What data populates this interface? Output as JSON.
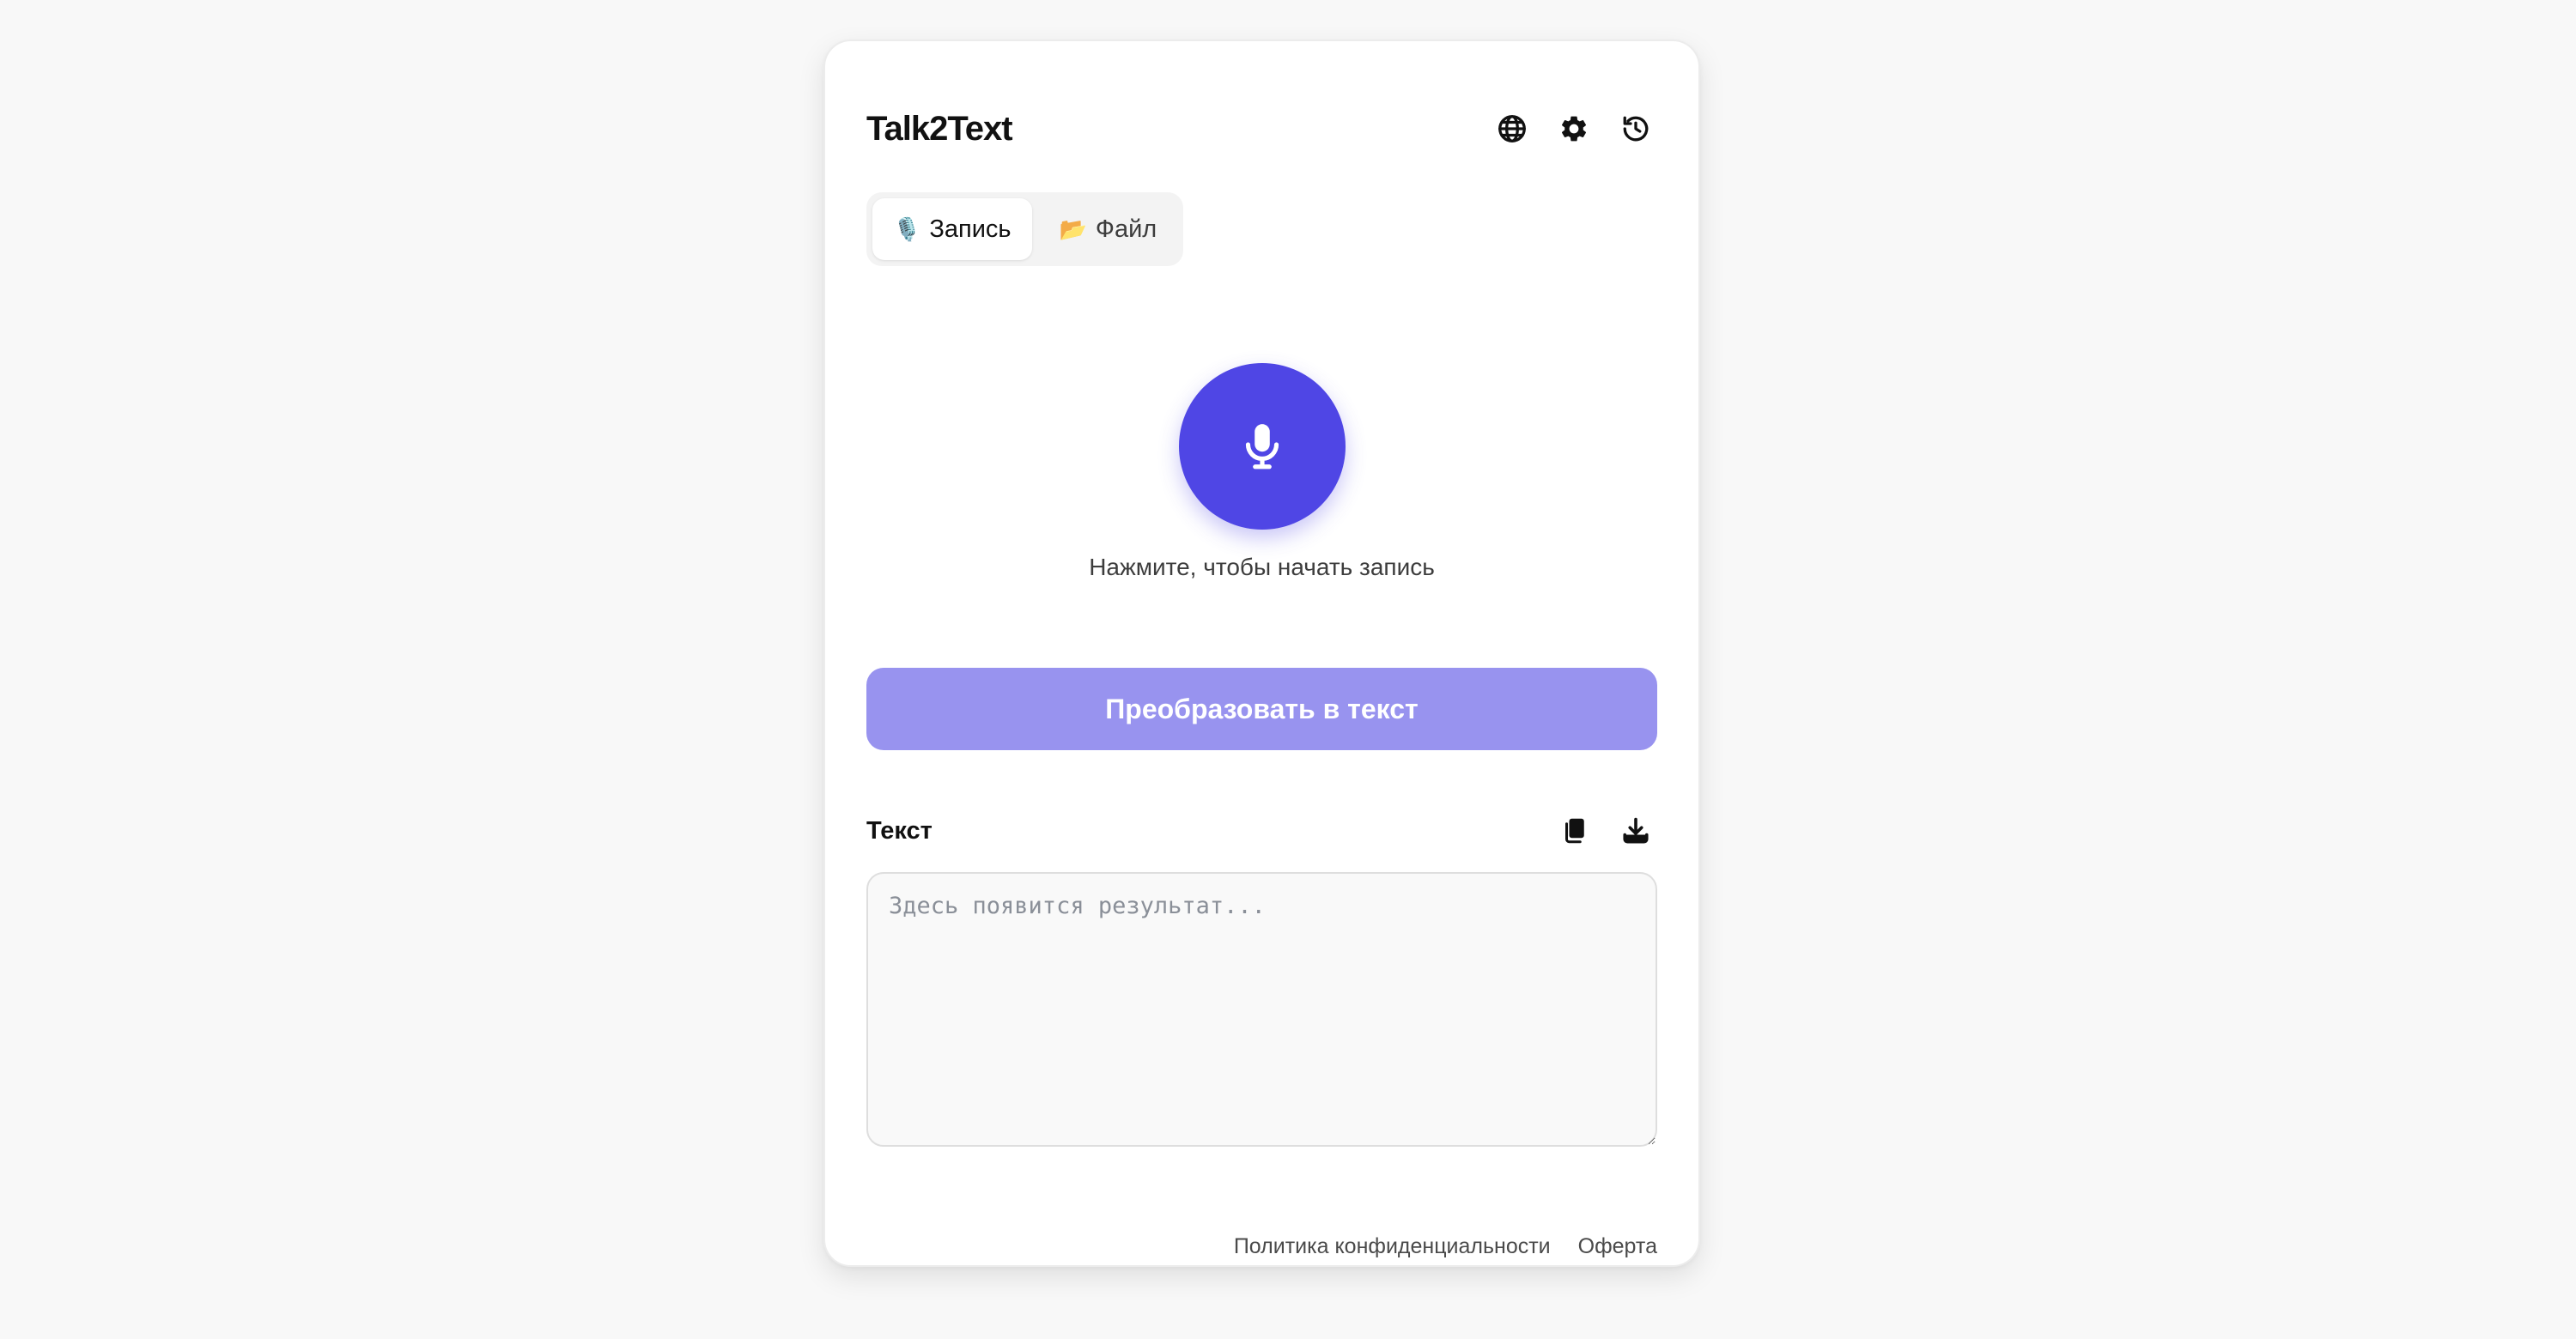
{
  "app": {
    "title": "Talk2Text"
  },
  "header": {
    "icons": [
      "globe-icon",
      "gear-icon",
      "history-icon"
    ]
  },
  "tabs": [
    {
      "icon": "🎙️",
      "label": "Запись",
      "active": true
    },
    {
      "icon": "📂",
      "label": "Файл",
      "active": false
    }
  ],
  "recorder": {
    "icon": "microphone-icon",
    "hint": "Нажмите, чтобы начать запись"
  },
  "convert": {
    "label": "Преобразовать в текст"
  },
  "result": {
    "label": "Текст",
    "placeholder": "Здесь появится результат...",
    "value": "",
    "icons": [
      "copy-icon",
      "download-icon"
    ]
  },
  "footer": {
    "privacy_label": "Политика конфиденциальности",
    "offer_label": "Оферта"
  },
  "colors": {
    "accent": "#4f46e5",
    "accent_disabled": "#9893ef",
    "background": "#f8f8f8",
    "card": "#ffffff"
  }
}
